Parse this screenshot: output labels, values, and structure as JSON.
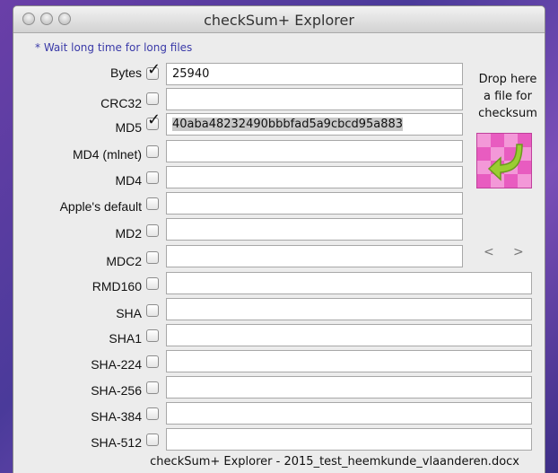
{
  "window": {
    "title": "checkSum+ Explorer"
  },
  "hint": "* Wait long time for long files",
  "rows": [
    {
      "label": "Bytes",
      "checked": true,
      "value": "25940"
    },
    {
      "label": "CRC32",
      "checked": false,
      "value": ""
    },
    {
      "label": "MD5",
      "checked": true,
      "value": "40aba48232490bbbfad5a9cbcd95a883"
    },
    {
      "label": "MD4 (mlnet)",
      "checked": false,
      "value": ""
    },
    {
      "label": "MD4",
      "checked": false,
      "value": ""
    },
    {
      "label": "Apple's default",
      "checked": false,
      "value": ""
    },
    {
      "label": "MD2",
      "checked": false,
      "value": ""
    },
    {
      "label": "MDC2",
      "checked": false,
      "value": ""
    },
    {
      "label": "RMD160",
      "checked": false,
      "value": ""
    },
    {
      "label": "SHA",
      "checked": false,
      "value": ""
    },
    {
      "label": "SHA1",
      "checked": false,
      "value": ""
    },
    {
      "label": "SHA-224",
      "checked": false,
      "value": ""
    },
    {
      "label": "SHA-256",
      "checked": false,
      "value": ""
    },
    {
      "label": "SHA-384",
      "checked": false,
      "value": ""
    },
    {
      "label": "SHA-512",
      "checked": false,
      "value": ""
    }
  ],
  "drop": {
    "text_line1": "Drop here",
    "text_line2": "a file for",
    "text_line3": "checksum",
    "icon": "drop-file-arrow-icon"
  },
  "nav": {
    "prev": "<",
    "next": ">"
  },
  "footer": "checkSum+ Explorer - 2015_test_heemkunde_vlaanderen.docx",
  "colors": {
    "drop_box": "#e85cc0",
    "hint_text": "#3a3aa8"
  }
}
